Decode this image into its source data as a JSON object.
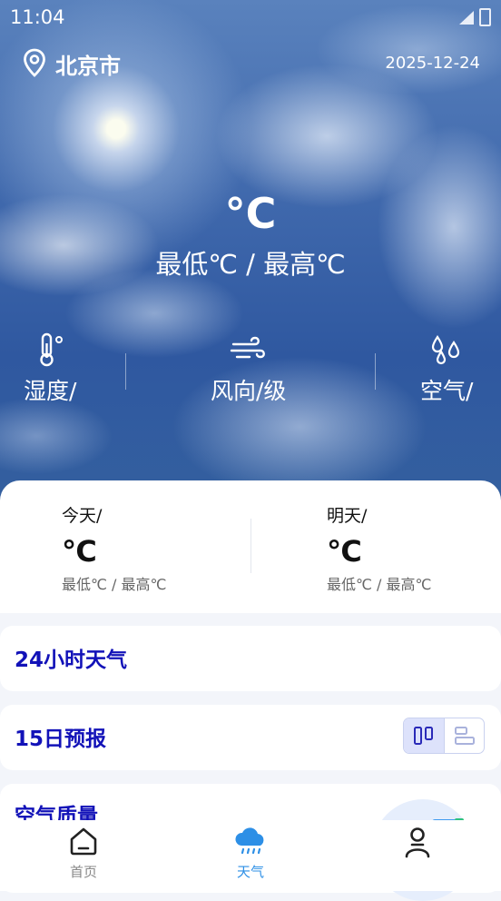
{
  "status_bar": {
    "time": "11:04"
  },
  "header": {
    "city": "北京市",
    "date": "2025-12-24"
  },
  "current": {
    "temperature": "°C",
    "range": "最低℃  /  最高℃"
  },
  "metrics": [
    {
      "label": "湿度/",
      "icon": "thermometer-icon"
    },
    {
      "label": "风向/级",
      "icon": "wind-icon"
    },
    {
      "label": "空气/",
      "icon": "air-drops-icon"
    }
  ],
  "forecast": {
    "today": {
      "label": "今天/",
      "temp": "℃",
      "range": "最低℃ / 最高℃"
    },
    "tomorrow": {
      "label": "明天/",
      "temp": "℃",
      "range": "最低℃ / 最高℃"
    }
  },
  "sections": {
    "hourly_title": "24小时天气",
    "daily_title": "15日预报",
    "air_quality_title": "空气质量"
  },
  "nav": {
    "home": "首页",
    "weather": "天气",
    "profile": ""
  },
  "colors": {
    "accent": "#1212b8",
    "nav_active": "#2d8fe6",
    "toggle_active_bg": "#dde2fb"
  }
}
